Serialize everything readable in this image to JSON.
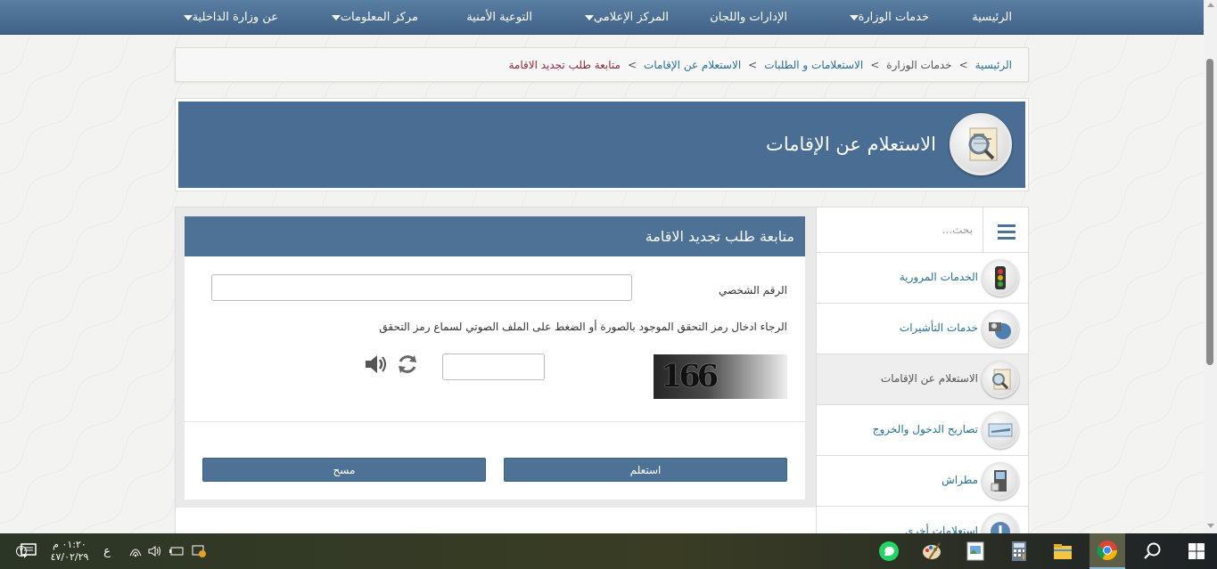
{
  "nav": {
    "items": [
      {
        "label": "الرئيسية",
        "dropdown": false
      },
      {
        "label": "خدمات الوزارة",
        "dropdown": true
      },
      {
        "label": "الإدارات واللجان",
        "dropdown": false
      },
      {
        "label": "المركز الإعلامي",
        "dropdown": true
      },
      {
        "label": "التوعية الأمنية",
        "dropdown": false
      },
      {
        "label": "مركز المعلومات",
        "dropdown": true
      },
      {
        "label": "عن وزارة الداخلية",
        "dropdown": true
      }
    ]
  },
  "breadcrumb": {
    "items": [
      "الرئيسية",
      "خدمات الوزارة",
      "الاستعلامات و الطلبات",
      "الاستعلام عن الإقامات"
    ],
    "current": "متابعة طلب تجديد الاقامة",
    "separator": ">"
  },
  "banner": {
    "title": "الاستعلام عن الإقامات",
    "icon": "residency-magnifier-icon"
  },
  "form": {
    "heading": "متابعة طلب تجديد الاقامة",
    "civil_id_label": "الرقم الشخصي",
    "civil_id_value": "",
    "captcha_instructions": "الرجاء ادخال رمز التحقق الموجود بالصورة أو الضغط على الملف الصوتي لسماع رمز التحقق",
    "captcha_text": "166",
    "captcha_value": "",
    "submit_label": "استعلم",
    "clear_label": "مسح"
  },
  "side": {
    "search_placeholder": "بحث...",
    "items": [
      {
        "label": "الخدمات المرورية",
        "icon": "traffic-light-icon",
        "active": false
      },
      {
        "label": "خدمات التأشيرات",
        "icon": "visa-icon",
        "active": false
      },
      {
        "label": "الاستعلام عن الإقامات",
        "icon": "residency-icon",
        "active": true
      },
      {
        "label": "تصاريح الدخول والخروج",
        "icon": "airplane-icon",
        "active": false
      },
      {
        "label": "مطراش",
        "icon": "kiosk-icon",
        "active": false
      },
      {
        "label": "استعلامات أخرى",
        "icon": "info-icon",
        "active": false
      }
    ]
  },
  "taskbar": {
    "time": "٠١:٢٠ م",
    "date": "٤٧/٠٢/٢٩",
    "lang": "ع",
    "notification_count": "٢"
  }
}
